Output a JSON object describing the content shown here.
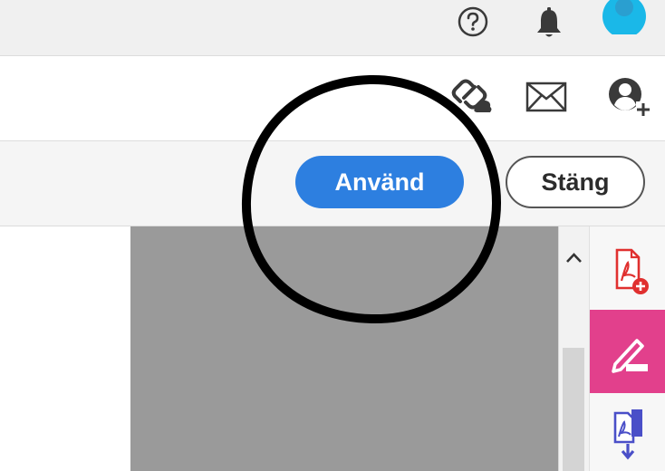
{
  "header": {
    "icons": {
      "help": "help-circle-icon",
      "notifications": "bell-icon",
      "avatar": "user-avatar"
    }
  },
  "doc_toolbar": {
    "icons": {
      "share_link": "link-icon",
      "email": "mail-icon",
      "add_user": "add-user-icon"
    }
  },
  "action_bar": {
    "apply_label": "Använd",
    "close_label": "Stäng"
  },
  "tool_rail": {
    "tools": [
      "create-pdf-icon",
      "fill-sign-icon",
      "export-pdf-icon"
    ],
    "active_tool": "fill-sign-icon"
  },
  "colors": {
    "accent": "#2d7fe0",
    "sign_tool": "#e2408c",
    "create_pdf": "#e0302f",
    "export_pdf": "#4a4fc8",
    "avatar": "#1ab8e8",
    "canvas": "#9a9a9a",
    "annotation": "#000000"
  }
}
